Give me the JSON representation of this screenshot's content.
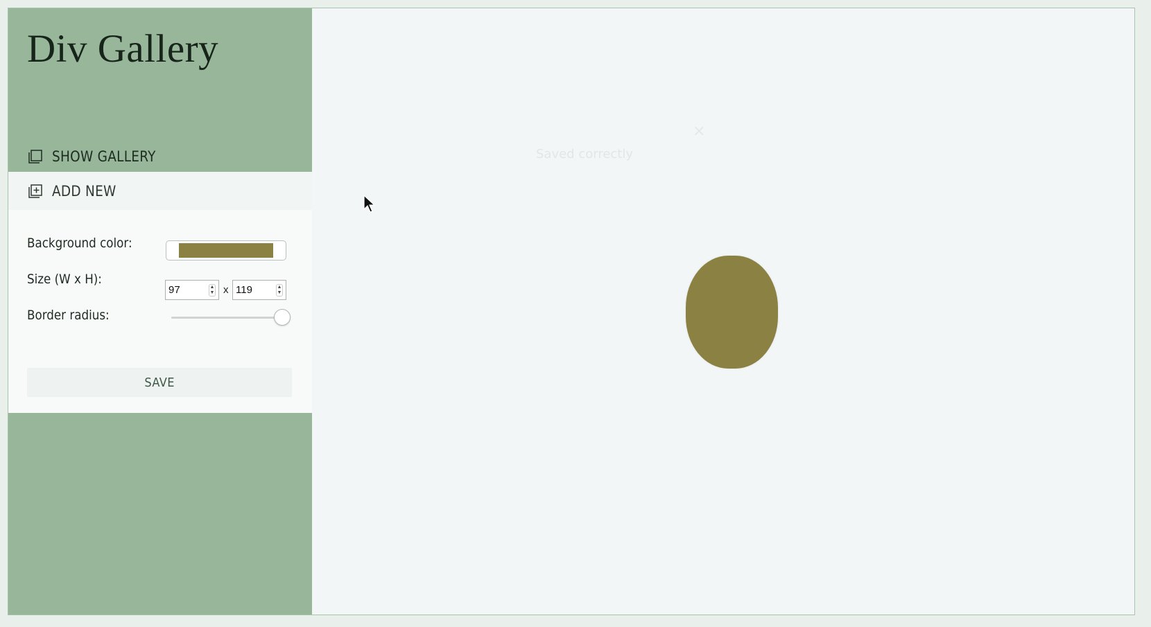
{
  "app": {
    "title": "Div Gallery"
  },
  "nav": {
    "show_gallery_label": "SHOW GALLERY",
    "show_gallery_icon": "gallery-icon",
    "add_new_label": "ADD NEW",
    "add_new_icon": "add-square-icon"
  },
  "form": {
    "background_color_label": "Background color:",
    "background_color_value": "#8a8142",
    "size_label": "Size (W x H):",
    "width_value": "97",
    "size_separator": "x",
    "height_value": "119",
    "border_radius_label": "Border radius:",
    "border_radius_level": 0.93,
    "save_label": "SAVE"
  },
  "toast": {
    "message": "Saved correctly",
    "close_glyph": "×"
  },
  "preview": {
    "background_color": "#8a8142"
  },
  "colors": {
    "sidebar": "#98b79a",
    "main_background": "#f2f6f6",
    "accent": "#8a8142"
  }
}
